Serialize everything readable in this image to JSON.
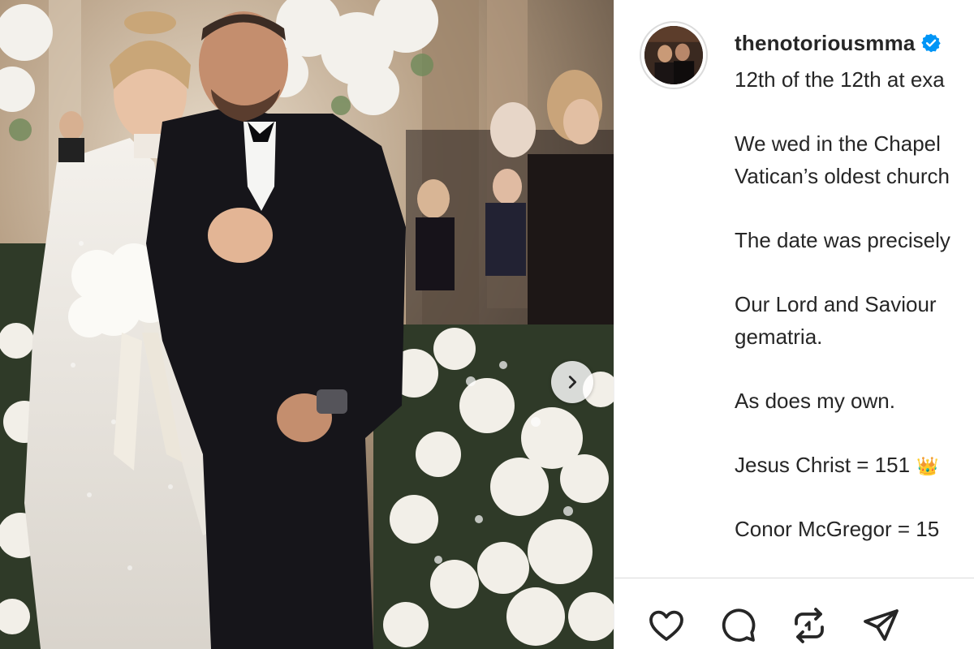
{
  "post": {
    "username": "thenotoriousmma",
    "verified": true,
    "caption_lines": [
      "12th of the 12th at exa",
      "",
      "We wed in the Chapel",
      "Vatican’s oldest church",
      "",
      "The date was precisely",
      "",
      "Our Lord and Saviour",
      "gematria.",
      "",
      "As does my own.",
      "",
      "Jesus Christ = 151",
      "",
      "Conor McGregor = 15"
    ],
    "crown_emoji": "👑"
  },
  "icons": {
    "verified": "verified-badge-icon",
    "next": "chevron-right-icon",
    "like": "heart-icon",
    "comment": "comment-bubble-icon",
    "repost": "repost-icon",
    "share": "send-paper-plane-icon"
  },
  "colors": {
    "text": "#262626",
    "verified_blue": "#0095f6",
    "divider": "#dbdbdb"
  }
}
